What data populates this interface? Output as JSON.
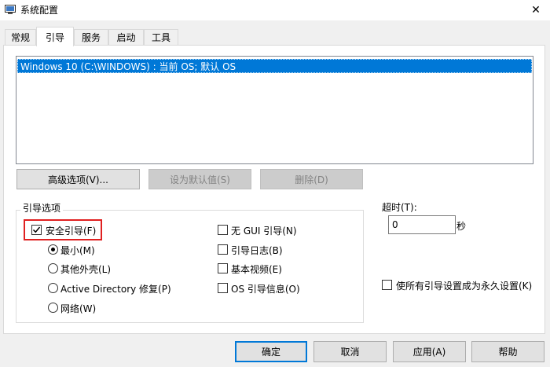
{
  "window": {
    "title": "系统配置",
    "close_symbol": "✕"
  },
  "tabs": [
    {
      "label": "常规",
      "active": false
    },
    {
      "label": "引导",
      "active": true
    },
    {
      "label": "服务",
      "active": false
    },
    {
      "label": "启动",
      "active": false
    },
    {
      "label": "工具",
      "active": false
    }
  ],
  "os_list": {
    "items": [
      "Windows 10 (C:\\WINDOWS) : 当前 OS; 默认 OS"
    ],
    "selected_index": 0
  },
  "os_buttons": {
    "advanced": "高级选项(V)...",
    "set_default": "设为默认值(S)",
    "delete": "删除(D)"
  },
  "boot_options": {
    "title": "引导选项",
    "safe_boot": {
      "label": "安全引导(F)",
      "checked": true
    },
    "radios": [
      {
        "label": "最小(M)",
        "selected": true
      },
      {
        "label": "其他外壳(L)",
        "selected": false
      },
      {
        "label": "Active Directory 修复(P)",
        "selected": false
      },
      {
        "label": "网络(W)",
        "selected": false
      }
    ],
    "right_checks": [
      {
        "label": "无 GUI 引导(N)",
        "checked": false
      },
      {
        "label": "引导日志(B)",
        "checked": false
      },
      {
        "label": "基本视频(E)",
        "checked": false
      },
      {
        "label": "OS 引导信息(O)",
        "checked": false
      }
    ]
  },
  "timeout": {
    "label": "超时(T):",
    "value": "0",
    "unit": "秒"
  },
  "permanent": {
    "label": "使所有引导设置成为永久设置(K)",
    "checked": false
  },
  "footer_buttons": {
    "ok": "确定",
    "cancel": "取消",
    "apply": "应用(A)",
    "help": "帮助"
  },
  "colors": {
    "selection": "#0078d7",
    "highlight_box": "#e02020",
    "dialog_bg": "#f0f0f0"
  }
}
